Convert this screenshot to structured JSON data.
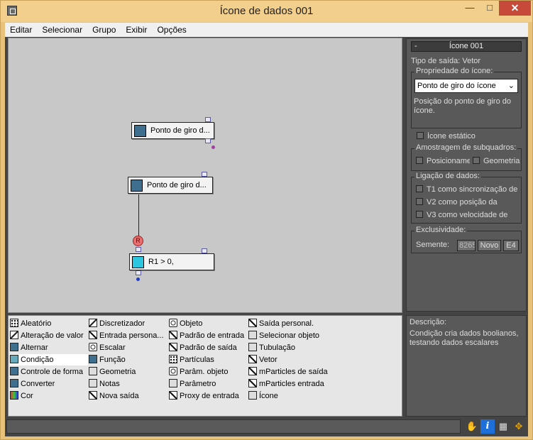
{
  "window": {
    "title": "Ícone de dados 001"
  },
  "menu": [
    "Editar",
    "Selecionar",
    "Grupo",
    "Exibir",
    "Opções"
  ],
  "nodes": [
    {
      "label": "Ponto de giro d..."
    },
    {
      "label": "Ponto de giro d..."
    },
    {
      "label": "R1 > 0,"
    }
  ],
  "wire_label": "R",
  "pane": {
    "rollout_title": "Ícone 001",
    "rollout_toggle": "-",
    "output_type": "Tipo de saída: Vetor",
    "prop_group": "Propriedade do ícone:",
    "prop_select": "Ponto de giro do ícone",
    "prop_desc": "Posição do ponto de giro do ícone.",
    "static_icon": "Ícone estático",
    "subframe_group": "Amostragem de subquadros:",
    "subframe_pos": "Posicionamento",
    "subframe_geo": "Geometria",
    "link_group": "Ligação de dados:",
    "link_t1": "T1 como sincronização de",
    "link_v2": "V2 como posição da",
    "link_v3": "V3 como velocidade de",
    "uniq_group": "Exclusividade:",
    "seed_label": "Semente:",
    "seed_value": "8265",
    "new_button": "Novo",
    "e4_button": "E4"
  },
  "palette": {
    "col1": [
      {
        "label": "Aleatório",
        "icon": "dots"
      },
      {
        "label": "Alteração de valor",
        "icon": "slash"
      },
      {
        "label": "Alternar",
        "icon": "blue"
      },
      {
        "label": "Condição",
        "icon": "cyan"
      },
      {
        "label": "Controle de forma",
        "icon": "blue"
      },
      {
        "label": "Converter",
        "icon": "blue"
      },
      {
        "label": "Cor",
        "icon": "rainbow"
      }
    ],
    "col2": [
      {
        "label": "Discretizador",
        "icon": "slash"
      },
      {
        "label": "Entrada persona...",
        "icon": "arrow"
      },
      {
        "label": "Escalar",
        "icon": "ring"
      },
      {
        "label": "Função",
        "icon": "blue"
      },
      {
        "label": "Geometria",
        "icon": "sel"
      },
      {
        "label": "Notas",
        "icon": "sel"
      },
      {
        "label": "Nova saída",
        "icon": "arrow"
      }
    ],
    "col3": [
      {
        "label": "Objeto",
        "icon": "ring"
      },
      {
        "label": "Padrão de entrada",
        "icon": "arrow"
      },
      {
        "label": "Padrão de saída",
        "icon": "arrow"
      },
      {
        "label": "Partículas",
        "icon": "dots"
      },
      {
        "label": "Parâm. objeto",
        "icon": "ring"
      },
      {
        "label": "Parâmetro",
        "icon": "sel"
      },
      {
        "label": "Proxy de entrada",
        "icon": "arrow"
      }
    ],
    "col4": [
      {
        "label": "Saída personal.",
        "icon": "arrow"
      },
      {
        "label": "Selecionar objeto",
        "icon": "sel"
      },
      {
        "label": "Tubulação",
        "icon": "sel"
      },
      {
        "label": "Vetor",
        "icon": "arrow"
      },
      {
        "label": "mParticles de saída",
        "icon": "arrow"
      },
      {
        "label": "mParticles entrada",
        "icon": "arrow"
      },
      {
        "label": "Ícone",
        "icon": "sel"
      }
    ]
  },
  "description": {
    "title": "Descrição:",
    "text": "Condição cria dados boolianos, testando dados escalares"
  },
  "status_icons": [
    "hand-icon",
    "info-icon",
    "node-icon",
    "move-icon"
  ]
}
